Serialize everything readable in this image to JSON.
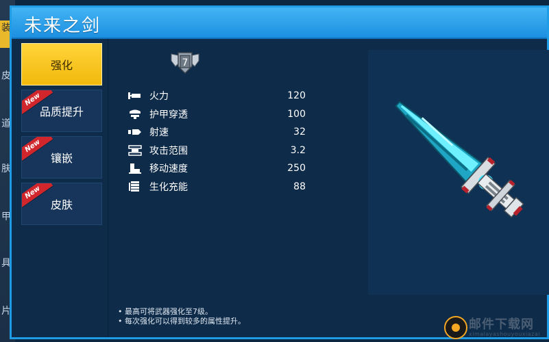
{
  "background_tabs": [
    "装",
    "皮",
    "道",
    "肤",
    "甲",
    "具",
    "片"
  ],
  "title": "未来之剑",
  "menu": [
    {
      "label": "强化",
      "active": true,
      "new": false
    },
    {
      "label": "品质提升",
      "active": false,
      "new": true
    },
    {
      "label": "镶嵌",
      "active": false,
      "new": true
    },
    {
      "label": "皮肤",
      "active": false,
      "new": true
    }
  ],
  "new_badge": "New",
  "level": "7",
  "stats": [
    {
      "icon": "firepower-icon",
      "label": "火力",
      "value": "120"
    },
    {
      "icon": "armor-piercing-icon",
      "label": "护甲穿透",
      "value": "100"
    },
    {
      "icon": "fire-rate-icon",
      "label": "射速",
      "value": "32"
    },
    {
      "icon": "attack-range-icon",
      "label": "攻击范围",
      "value": "3.2"
    },
    {
      "icon": "move-speed-icon",
      "label": "移动速度",
      "value": "250"
    },
    {
      "icon": "bio-charge-icon",
      "label": "生化充能",
      "value": "88"
    }
  ],
  "notes": [
    "• 最高可将武器强化至7级。",
    "• 每次强化可以得到较多的属性提升。"
  ],
  "watermark": {
    "text": "邮件下载网",
    "sub": "ximalayashouyouxiazai"
  },
  "colors": {
    "accent": "#1e9de6",
    "active_tab": "#f1b90c",
    "new_ribbon": "#d1262c",
    "blade": "#22d3e8"
  }
}
